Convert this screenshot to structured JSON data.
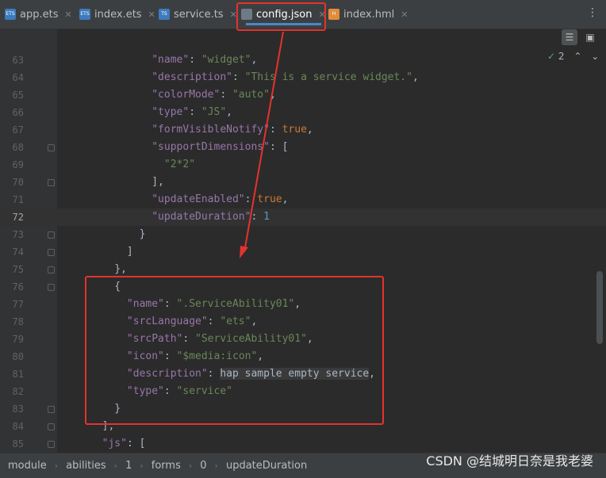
{
  "tabs": [
    {
      "label": "app.ets",
      "icon": "ets-file-icon",
      "badge": "ETS",
      "color": "#3d7bbf"
    },
    {
      "label": "index.ets",
      "icon": "ets-file-icon",
      "badge": "ETS",
      "color": "#3d7bbf"
    },
    {
      "label": "service.ts",
      "icon": "ts-file-icon",
      "badge": "TS",
      "color": "#3d7bbf"
    },
    {
      "label": "config.json",
      "icon": "json-file-icon",
      "badge": "",
      "color": "#6e7a85",
      "active": true
    },
    {
      "label": "index.hml",
      "icon": "hml-file-icon",
      "badge": "H",
      "color": "#e08c3a"
    }
  ],
  "inspection": {
    "count": "2"
  },
  "lines": [
    {
      "num": "63",
      "tokens": [
        {
          "t": "p",
          "v": "                "
        },
        {
          "t": "k",
          "v": "\"name\""
        },
        {
          "t": "p",
          "v": ": "
        },
        {
          "t": "s",
          "v": "\"widget\""
        },
        {
          "t": "p",
          "v": ","
        }
      ]
    },
    {
      "num": "64",
      "tokens": [
        {
          "t": "p",
          "v": "                "
        },
        {
          "t": "k",
          "v": "\"description\""
        },
        {
          "t": "p",
          "v": ": "
        },
        {
          "t": "s",
          "v": "\"This is a service widget.\""
        },
        {
          "t": "p",
          "v": ","
        }
      ]
    },
    {
      "num": "65",
      "tokens": [
        {
          "t": "p",
          "v": "                "
        },
        {
          "t": "k",
          "v": "\"colorMode\""
        },
        {
          "t": "p",
          "v": ": "
        },
        {
          "t": "s",
          "v": "\"auto\""
        },
        {
          "t": "p",
          "v": ","
        }
      ]
    },
    {
      "num": "66",
      "tokens": [
        {
          "t": "p",
          "v": "                "
        },
        {
          "t": "k",
          "v": "\"type\""
        },
        {
          "t": "p",
          "v": ": "
        },
        {
          "t": "s",
          "v": "\"JS\""
        },
        {
          "t": "p",
          "v": ","
        }
      ]
    },
    {
      "num": "67",
      "tokens": [
        {
          "t": "p",
          "v": "                "
        },
        {
          "t": "k",
          "v": "\"formVisibleNotify\""
        },
        {
          "t": "p",
          "v": ": "
        },
        {
          "t": "b",
          "v": "true"
        },
        {
          "t": "p",
          "v": ","
        }
      ]
    },
    {
      "num": "68",
      "tokens": [
        {
          "t": "p",
          "v": "                "
        },
        {
          "t": "k",
          "v": "\"supportDimensions\""
        },
        {
          "t": "p",
          "v": ": ["
        }
      ]
    },
    {
      "num": "69",
      "tokens": [
        {
          "t": "p",
          "v": "                  "
        },
        {
          "t": "s",
          "v": "\"2*2\""
        }
      ]
    },
    {
      "num": "70",
      "tokens": [
        {
          "t": "p",
          "v": "                ],"
        }
      ]
    },
    {
      "num": "71",
      "tokens": [
        {
          "t": "p",
          "v": "                "
        },
        {
          "t": "k",
          "v": "\"updateEnabled\""
        },
        {
          "t": "p",
          "v": ": "
        },
        {
          "t": "b",
          "v": "true"
        },
        {
          "t": "p",
          "v": ","
        }
      ]
    },
    {
      "num": "72",
      "tokens": [
        {
          "t": "p",
          "v": "                "
        },
        {
          "t": "k",
          "v": "\"updateDuration\""
        },
        {
          "t": "p",
          "v": ": "
        },
        {
          "t": "n",
          "v": "1"
        }
      ],
      "current": true
    },
    {
      "num": "73",
      "tokens": [
        {
          "t": "p",
          "v": "              }"
        }
      ]
    },
    {
      "num": "74",
      "tokens": [
        {
          "t": "p",
          "v": "            ]"
        }
      ]
    },
    {
      "num": "75",
      "tokens": [
        {
          "t": "p",
          "v": "          },"
        }
      ]
    },
    {
      "num": "76",
      "tokens": [
        {
          "t": "p",
          "v": "          {"
        }
      ]
    },
    {
      "num": "77",
      "tokens": [
        {
          "t": "p",
          "v": "            "
        },
        {
          "t": "k",
          "v": "\"name\""
        },
        {
          "t": "p",
          "v": ": "
        },
        {
          "t": "s",
          "v": "\".ServiceAbility01\""
        },
        {
          "t": "p",
          "v": ","
        }
      ]
    },
    {
      "num": "78",
      "tokens": [
        {
          "t": "p",
          "v": "            "
        },
        {
          "t": "k",
          "v": "\"srcLanguage\""
        },
        {
          "t": "p",
          "v": ": "
        },
        {
          "t": "s",
          "v": "\"ets\""
        },
        {
          "t": "p",
          "v": ","
        }
      ]
    },
    {
      "num": "79",
      "tokens": [
        {
          "t": "p",
          "v": "            "
        },
        {
          "t": "k",
          "v": "\"srcPath\""
        },
        {
          "t": "p",
          "v": ": "
        },
        {
          "t": "s",
          "v": "\"ServiceAbility01\""
        },
        {
          "t": "p",
          "v": ","
        }
      ]
    },
    {
      "num": "80",
      "tokens": [
        {
          "t": "p",
          "v": "            "
        },
        {
          "t": "k",
          "v": "\"icon\""
        },
        {
          "t": "p",
          "v": ": "
        },
        {
          "t": "s",
          "v": "\"$media:icon\""
        },
        {
          "t": "p",
          "v": ","
        }
      ]
    },
    {
      "num": "81",
      "tokens": [
        {
          "t": "p",
          "v": "            "
        },
        {
          "t": "k",
          "v": "\"description\""
        },
        {
          "t": "p",
          "v": ": "
        },
        {
          "t": "plain",
          "v": "hap sample empty service"
        },
        {
          "t": "p",
          "v": ","
        }
      ]
    },
    {
      "num": "82",
      "tokens": [
        {
          "t": "p",
          "v": "            "
        },
        {
          "t": "k",
          "v": "\"type\""
        },
        {
          "t": "p",
          "v": ": "
        },
        {
          "t": "s",
          "v": "\"service\""
        }
      ]
    },
    {
      "num": "83",
      "tokens": [
        {
          "t": "p",
          "v": "          }"
        }
      ]
    },
    {
      "num": "84",
      "tokens": [
        {
          "t": "p",
          "v": "        ],"
        }
      ]
    },
    {
      "num": "85",
      "tokens": [
        {
          "t": "p",
          "v": "        "
        },
        {
          "t": "k",
          "v": "\"js\""
        },
        {
          "t": "p",
          "v": ": ["
        }
      ]
    }
  ],
  "breadcrumbs": [
    "module",
    "abilities",
    "1",
    "forms",
    "0",
    "updateDuration"
  ],
  "watermark": "CSDN @结城明日奈是我老婆",
  "colors": {
    "annotation": "#e5322e",
    "accent": "#4a88c7"
  }
}
